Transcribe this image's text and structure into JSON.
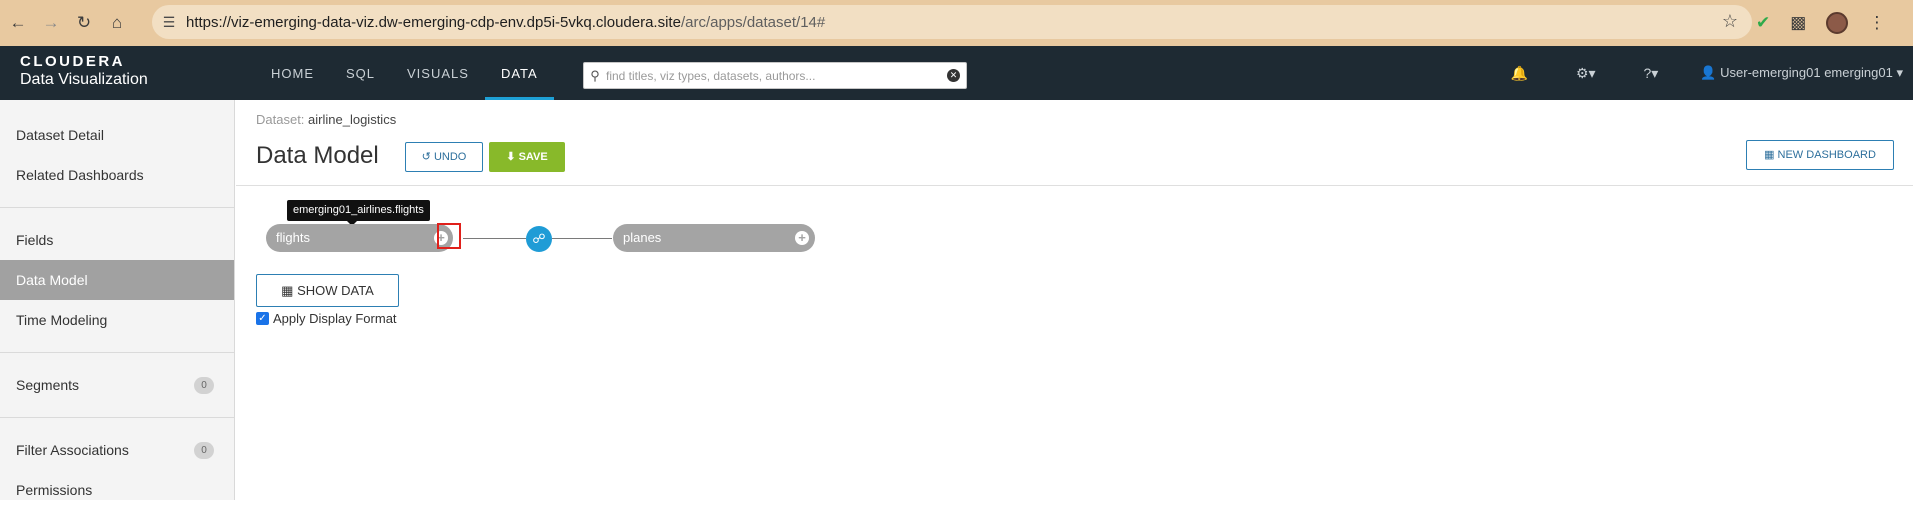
{
  "browser": {
    "url_main": "https://viz-emerging-data-viz.dw-emerging-cdp-env.dp5i-5vkq.cloudera.site",
    "url_path": "/arc/apps/dataset/14#",
    "icons": [
      "back-arrow-icon",
      "forward-arrow-icon",
      "reload-icon",
      "home-icon",
      "site-settings-icon",
      "bookmark-star-icon",
      "extension-icon",
      "puzzle-icon",
      "profile-avatar"
    ]
  },
  "header": {
    "brand": "CLOUDERA",
    "product": "Data Visualization",
    "tabs": [
      {
        "label": "HOME"
      },
      {
        "label": "SQL"
      },
      {
        "label": "VISUALS"
      },
      {
        "label": "DATA"
      }
    ],
    "active_tab": "DATA",
    "search_placeholder": "find titles, viz types, datasets, authors...",
    "user_label": "User-emerging01 emerging01"
  },
  "sidebar": {
    "items": [
      {
        "label": "Dataset Detail"
      },
      {
        "label": "Related Dashboards"
      },
      {
        "label": "Fields"
      },
      {
        "label": "Data Model"
      },
      {
        "label": "Time Modeling"
      },
      {
        "label": "Segments",
        "badge": "0"
      },
      {
        "label": "Filter Associations",
        "badge": "0"
      },
      {
        "label": "Permissions"
      }
    ],
    "active_item": "Data Model"
  },
  "main": {
    "crumb_label": "Dataset:",
    "crumb_value": "airline_logistics",
    "title": "Data Model",
    "undo_label": "UNDO",
    "save_label": "SAVE",
    "new_dashboard_label": "NEW DASHBOARD",
    "tooltip": "emerging01_airlines.flights",
    "nodes": [
      {
        "label": "flights"
      },
      {
        "label": "planes"
      }
    ],
    "show_data_label": "SHOW DATA",
    "apply_format_label": "Apply Display Format",
    "apply_format_checked": true
  },
  "colors": {
    "header_bg": "#1e2a33",
    "active_tab_underline": "#1ea0d6",
    "save_green": "#88b92a",
    "join_blue": "#1f9cd6",
    "node_gray": "#a4a4a4",
    "highlight_red": "#e0201b"
  }
}
